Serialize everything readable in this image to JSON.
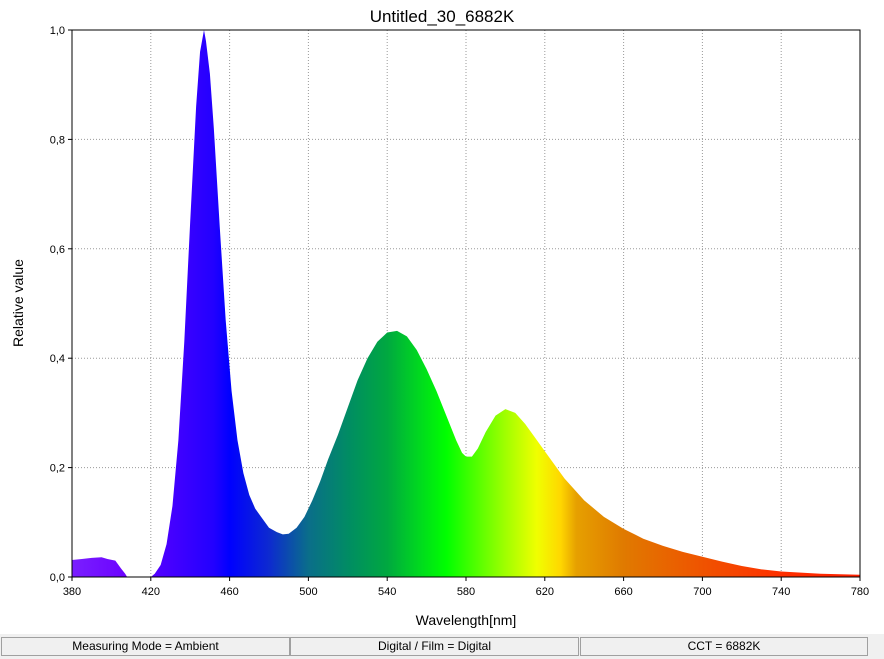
{
  "chart_data": {
    "type": "area",
    "title": "Untitled_30_6882K",
    "xlabel": "Wavelength[nm]",
    "ylabel": "Relative value",
    "xlim": [
      380,
      780
    ],
    "ylim": [
      0,
      1.0
    ],
    "x_ticks": [
      "380",
      "420",
      "460",
      "500",
      "540",
      "580",
      "620",
      "660",
      "700",
      "740",
      "780"
    ],
    "y_ticks": [
      "0,0",
      "0,2",
      "0,4",
      "0,6",
      "0,8",
      "1,0"
    ],
    "grid": true,
    "x": [
      380,
      385,
      390,
      395,
      398,
      402,
      405,
      407,
      408,
      420,
      422,
      425,
      428,
      431,
      434,
      437,
      440,
      443,
      445,
      447,
      448,
      450,
      452,
      455,
      458,
      461,
      464,
      467,
      470,
      473,
      476,
      480,
      484,
      487,
      490,
      494,
      498,
      502,
      506,
      510,
      515,
      520,
      525,
      530,
      535,
      540,
      545,
      550,
      555,
      560,
      565,
      570,
      575,
      578,
      580,
      583,
      586,
      590,
      595,
      600,
      605,
      610,
      615,
      620,
      625,
      630,
      640,
      650,
      660,
      670,
      680,
      690,
      700,
      710,
      720,
      730,
      740,
      750,
      760,
      770,
      780
    ],
    "y": [
      0.031,
      0.033,
      0.035,
      0.036,
      0.033,
      0.03,
      0.015,
      0.006,
      0.0,
      0.0,
      0.006,
      0.022,
      0.06,
      0.13,
      0.25,
      0.43,
      0.65,
      0.86,
      0.96,
      1.0,
      0.98,
      0.92,
      0.82,
      0.64,
      0.47,
      0.34,
      0.25,
      0.19,
      0.15,
      0.125,
      0.11,
      0.09,
      0.082,
      0.078,
      0.079,
      0.09,
      0.11,
      0.14,
      0.175,
      0.215,
      0.26,
      0.31,
      0.36,
      0.4,
      0.43,
      0.447,
      0.45,
      0.44,
      0.415,
      0.38,
      0.34,
      0.295,
      0.25,
      0.227,
      0.22,
      0.22,
      0.235,
      0.265,
      0.295,
      0.307,
      0.3,
      0.28,
      0.255,
      0.23,
      0.205,
      0.18,
      0.14,
      0.11,
      0.088,
      0.07,
      0.057,
      0.046,
      0.037,
      0.028,
      0.02,
      0.014,
      0.01,
      0.008,
      0.006,
      0.005,
      0.004
    ]
  },
  "status": {
    "measuring_mode": "Measuring Mode = Ambient",
    "digital_film": "Digital / Film = Digital",
    "cct": "CCT = 6882K"
  }
}
